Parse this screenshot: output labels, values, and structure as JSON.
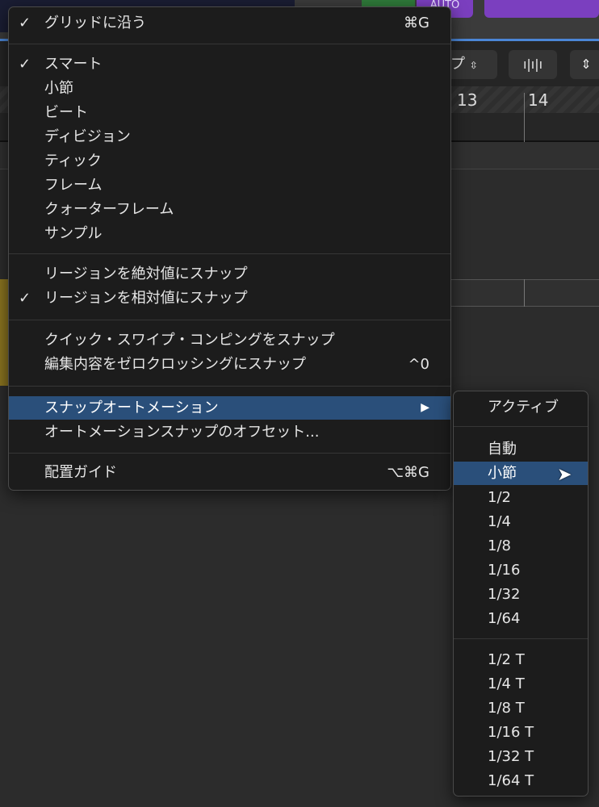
{
  "background": {
    "ruler": [
      "13",
      "14"
    ],
    "auto_label": "AUTO",
    "mode_fragment": "プ"
  },
  "menu": {
    "items": [
      {
        "label": "グリッドに沿う",
        "checked": true,
        "shortcut": "⌘G"
      },
      {
        "label": "スマート",
        "checked": true
      },
      {
        "label": "小節"
      },
      {
        "label": "ビート"
      },
      {
        "label": "ディビジョン"
      },
      {
        "label": "ティック"
      },
      {
        "label": "フレーム"
      },
      {
        "label": "クォーターフレーム"
      },
      {
        "label": "サンプル"
      },
      {
        "label": "リージョンを絶対値にスナップ"
      },
      {
        "label": "リージョンを相対値にスナップ",
        "checked": true
      },
      {
        "label": "クイック・スワイプ・コンピングをスナップ"
      },
      {
        "label": "編集内容をゼロクロッシングにスナップ",
        "shortcut": "^0"
      },
      {
        "label": "スナップオートメーション",
        "highlighted": true,
        "submenu_arrow": "▶"
      },
      {
        "label": "オートメーションスナップのオフセット..."
      },
      {
        "label": "配置ガイド",
        "shortcut": "⌥⌘G"
      }
    ],
    "checkmark": "✓"
  },
  "submenu": {
    "items": [
      "アクティブ",
      "自動",
      "小節",
      "1/2",
      "1/4",
      "1/8",
      "1/16",
      "1/32",
      "1/64",
      "1/2 T",
      "1/4 T",
      "1/8 T",
      "1/16 T",
      "1/32 T",
      "1/64 T"
    ],
    "selected": "小節"
  },
  "colors": {
    "highlight": "#2a4f7a",
    "menu_bg": "#1c1c1c",
    "purple": "#7b3fbf"
  }
}
